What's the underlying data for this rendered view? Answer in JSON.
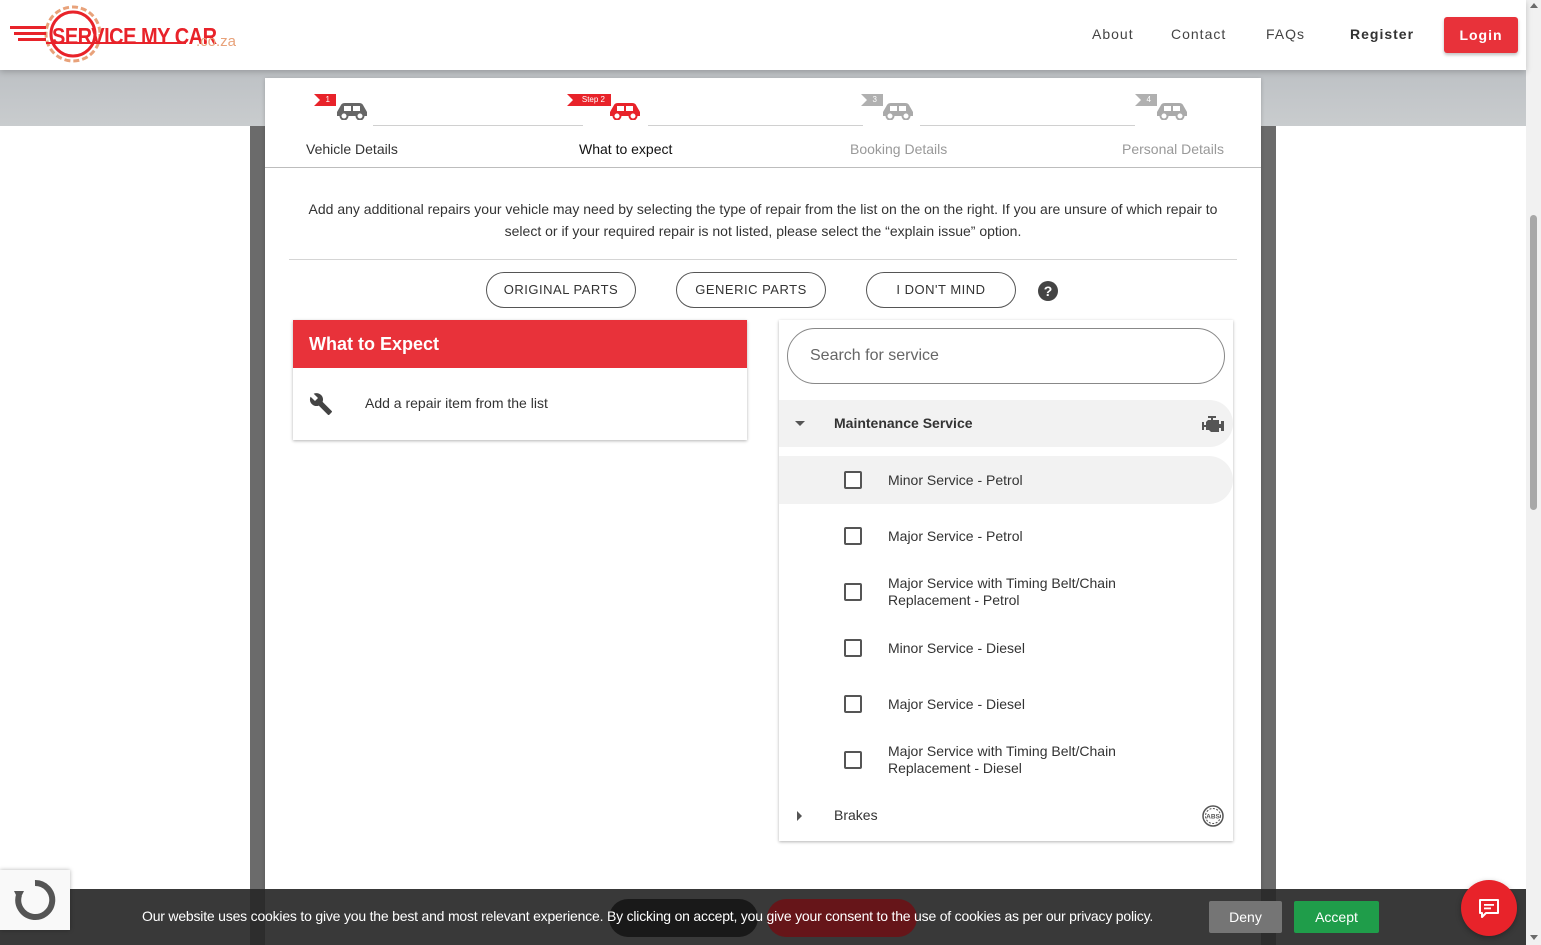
{
  "header": {
    "logo_text": "SERVICE MY CAR",
    "logo_domain": ".co.za",
    "nav": [
      "About",
      "Contact",
      "FAQs",
      "Register"
    ],
    "login_label": "Login"
  },
  "stepper": {
    "steps": [
      {
        "flag": "1",
        "label": "Vehicle Details",
        "state": "done"
      },
      {
        "flag": "Step 2",
        "label": "What to expect",
        "state": "active"
      },
      {
        "flag": "3",
        "label": "Booking Details",
        "state": "pending"
      },
      {
        "flag": "4",
        "label": "Personal Details",
        "state": "pending"
      }
    ]
  },
  "intro_text": "Add any additional repairs your vehicle may need by selecting the type of repair from the list on the on the right. If you are unsure of which repair to select or if your required repair is not listed, please select the “explain issue” option.",
  "parts_options": [
    "ORIGINAL PARTS",
    "GENERIC PARTS",
    "I DON'T MIND"
  ],
  "help_icon": "?",
  "what_to_expect": {
    "title": "What to Expect",
    "empty_text": "Add a repair item from the list",
    "icon": "wrench-icon"
  },
  "services": {
    "search_placeholder": "Search for service",
    "categories": [
      {
        "name": "Maintenance Service",
        "expanded": true,
        "icon": "engine-icon",
        "items": [
          {
            "label": "Minor Service - Petrol",
            "checked": false
          },
          {
            "label": "Major Service - Petrol",
            "checked": false
          },
          {
            "label": "Major Service with Timing Belt/Chain Replacement - Petrol",
            "checked": false
          },
          {
            "label": "Minor Service - Diesel",
            "checked": false
          },
          {
            "label": "Major Service - Diesel",
            "checked": false
          },
          {
            "label": "Major Service with Timing Belt/Chain Replacement - Diesel",
            "checked": false
          }
        ]
      },
      {
        "name": "Brakes",
        "expanded": false,
        "icon": "abs-icon",
        "items": []
      }
    ]
  },
  "cookie": {
    "text": "Our website uses cookies to give you the best and most relevant experience. By clicking on accept, you give your consent to the use of cookies as per our privacy policy.",
    "deny_label": "Deny",
    "accept_label": "Accept"
  },
  "colors": {
    "brand_red": "#e8323a",
    "accept_green": "#1f9d4a",
    "deny_gray": "#757575"
  }
}
